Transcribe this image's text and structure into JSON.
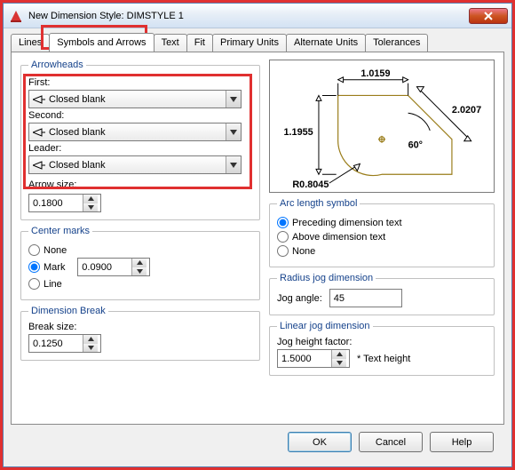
{
  "window": {
    "title": "New Dimension Style: DIMSTYLE 1"
  },
  "tabs": {
    "lines": "Lines",
    "symbols": "Symbols and Arrows",
    "text": "Text",
    "fit": "Fit",
    "primary": "Primary Units",
    "alternate": "Alternate Units",
    "tolerances": "Tolerances"
  },
  "arrowheads": {
    "legend": "Arrowheads",
    "first_label": "First:",
    "first_value": "Closed blank",
    "second_label": "Second:",
    "second_value": "Closed blank",
    "leader_label": "Leader:",
    "leader_value": "Closed blank",
    "size_label": "Arrow size:",
    "size_value": "0.1800"
  },
  "center_marks": {
    "legend": "Center marks",
    "none": "None",
    "mark": "Mark",
    "line": "Line",
    "value": "0.0900"
  },
  "dim_break": {
    "legend": "Dimension Break",
    "label": "Break size:",
    "value": "0.1250"
  },
  "preview": {
    "d1": "1.0159",
    "d2": "1.1955",
    "d3": "2.0207",
    "ang": "60°",
    "rad": "R0.8045"
  },
  "arc": {
    "legend": "Arc length symbol",
    "preceding": "Preceding dimension text",
    "above": "Above dimension text",
    "none": "None"
  },
  "radius_jog": {
    "legend": "Radius jog dimension",
    "label": "Jog angle:",
    "value": "45"
  },
  "linear_jog": {
    "legend": "Linear jog dimension",
    "label": "Jog height factor:",
    "value": "1.5000",
    "suffix": "* Text height"
  },
  "buttons": {
    "ok": "OK",
    "cancel": "Cancel",
    "help": "Help"
  }
}
